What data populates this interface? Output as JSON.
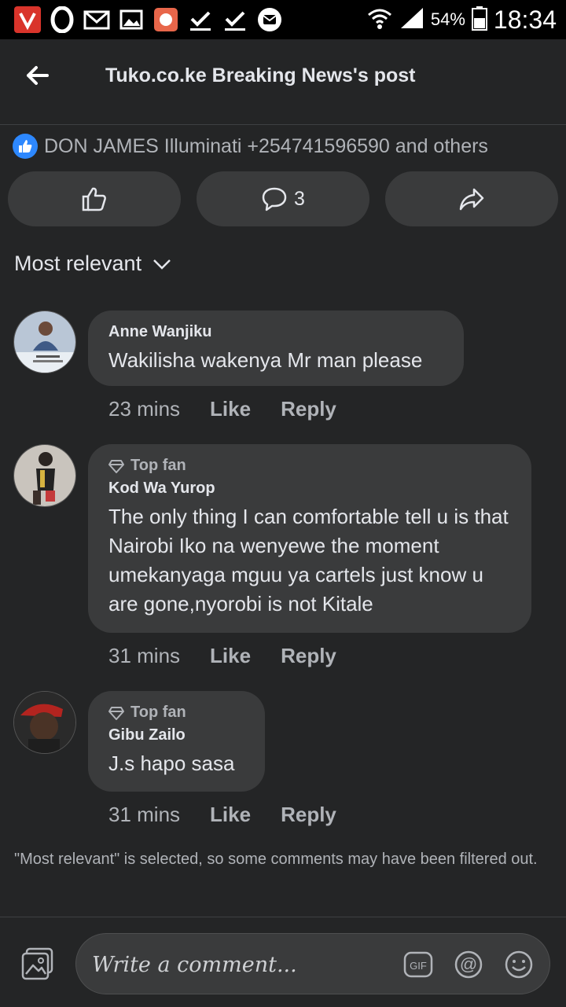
{
  "status_bar": {
    "battery": "54%",
    "time": "18:34"
  },
  "header": {
    "title": "Tuko.co.ke Breaking News's post"
  },
  "reactions": {
    "text": "DON JAMES Illuminati +254741596590 and others"
  },
  "actions": {
    "comment_count": "3"
  },
  "sort": {
    "label": "Most relevant"
  },
  "comments": [
    {
      "author": "Anne Wanjiku",
      "badge": "",
      "text": "Wakilisha wakenya Mr man please",
      "time": "23 mins",
      "like": "Like",
      "reply": "Reply"
    },
    {
      "author": "Kod Wa Yurop",
      "badge": "Top fan",
      "text": "The only thing I can comfortable tell u is that Nairobi Iko na wenyewe the moment umekanyaga mguu ya cartels just know u are gone,nyorobi is not Kitale",
      "time": "31 mins",
      "like": "Like",
      "reply": "Reply"
    },
    {
      "author": "Gibu Zailo",
      "badge": "Top fan",
      "text": "J.s hapo sasa",
      "time": "31 mins",
      "like": "Like",
      "reply": "Reply"
    }
  ],
  "filter_note": "\"Most relevant\" is selected, so some comments may have been filtered out.",
  "composer": {
    "placeholder": "Write a comment..."
  },
  "icons": {
    "status_left": [
      "vivaldi-icon",
      "opera-icon",
      "mail-icon",
      "gallery-icon",
      "app-icon",
      "download-done-icon",
      "download-done-icon",
      "message-icon"
    ],
    "status_right": [
      "wifi-icon",
      "signal-icon",
      "battery-icon"
    ],
    "composer": [
      "photo-icon",
      "gif-icon",
      "mention-icon",
      "emoji-icon"
    ]
  },
  "colors": {
    "background": "#242526",
    "bubble": "#3a3b3c",
    "accent": "#2d88ff",
    "secondary_text": "#b0b3b8"
  }
}
